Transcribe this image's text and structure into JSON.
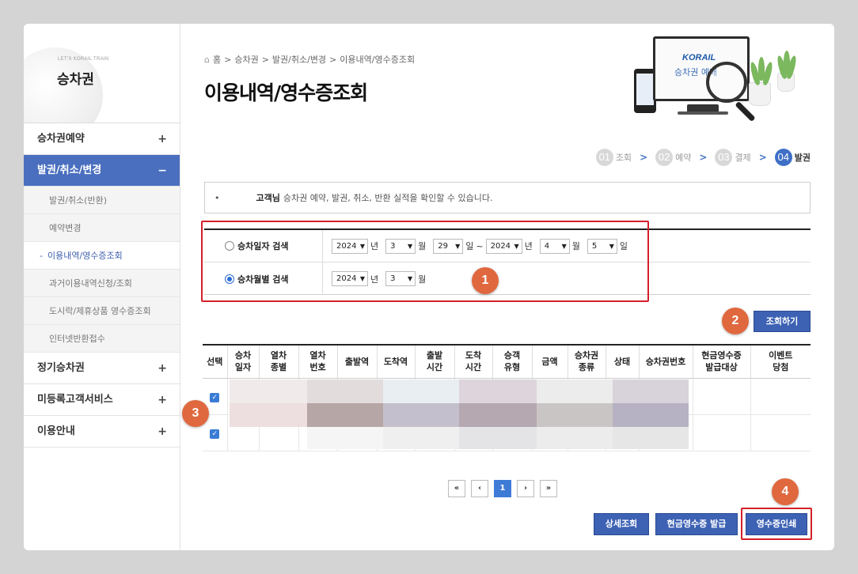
{
  "sidebar": {
    "sub_title": "LET'S KORAIL TRAIN",
    "title": "승차권",
    "menu": [
      {
        "label": "승차권예약",
        "toggle": "+"
      },
      {
        "label": "발권/취소/변경",
        "toggle": "−"
      },
      {
        "label": "정기승차권",
        "toggle": "+"
      },
      {
        "label": "미등록고객서비스",
        "toggle": "+"
      },
      {
        "label": "이용안내",
        "toggle": "+"
      }
    ],
    "sub_items": [
      "발권/취소(반환)",
      "예약변경",
      "이용내역/영수증조회",
      "과거이용내역신청/조회",
      "도시락/제휴상품 영수증조회",
      "인터넷반환접수"
    ]
  },
  "breadcrumb": [
    "홈",
    "승차권",
    "발권/취소/변경",
    "이용내역/영수증조회"
  ],
  "breadcrumb_sep": ">",
  "page_title": "이용내역/영수증조회",
  "illustration": {
    "brand": "KORAIL",
    "text": "승차권 예매"
  },
  "steps": [
    {
      "num": "01",
      "label": "조회"
    },
    {
      "num": "02",
      "label": "예약"
    },
    {
      "num": "03",
      "label": "결제"
    },
    {
      "num": "04",
      "label": "발권"
    }
  ],
  "step_arrow": ">",
  "info": {
    "bullet": "•",
    "name": "고객님",
    "text": "승차권 예약, 발권, 취소, 반환 실적을 확인할 수 있습니다."
  },
  "search": {
    "date_search_label": "승차일자 검색",
    "month_search_label": "승차월별 검색",
    "selected": "month",
    "from": {
      "year": "2024",
      "month": "3",
      "day": "29"
    },
    "to": {
      "year": "2024",
      "month": "4",
      "day": "5"
    },
    "monthly": {
      "year": "2024",
      "month": "3"
    },
    "unit_year": "년",
    "unit_month": "월",
    "unit_day": "일",
    "range_sep": "~"
  },
  "badges": [
    "1",
    "2",
    "3",
    "4"
  ],
  "buttons": {
    "search": "조회하기",
    "detail": "상세조회",
    "cash_receipt": "현금영수증 발급",
    "print_receipt": "영수증인쇄"
  },
  "table": {
    "headers": [
      "선택",
      "승차\n일자",
      "열차\n종별",
      "열차\n번호",
      "출발역",
      "도착역",
      "출발\n시간",
      "도착\n시간",
      "승객\n유형",
      "금액",
      "승차권\n종류",
      "상태",
      "승차권번호",
      "현금영수증\n발급대상",
      "이벤트\n당첨"
    ],
    "rows_checked": [
      true,
      true
    ]
  },
  "pagination": [
    "«",
    "‹",
    "1",
    "›",
    "»"
  ],
  "colors": {
    "accent": "#3d62b4",
    "highlight_red": "#d3202a",
    "badge": "#e0683e",
    "active_menu": "#4a6fbf"
  }
}
